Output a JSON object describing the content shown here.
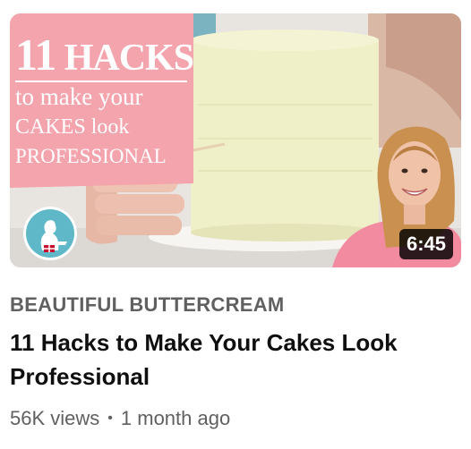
{
  "thumbnail": {
    "title_number": "11",
    "title_word": "HACKS",
    "title_line2": "to make your",
    "title_line3": "CAKES look",
    "title_line4": "PROFESSIONAL",
    "duration": "6:45",
    "logo_icon": "beautiful-buttercream-logo-icon",
    "panel_color": "#f4a4ad",
    "cake_color": "#efefc8"
  },
  "channel": {
    "name": "BEAUTIFUL BUTTERCREAM"
  },
  "video": {
    "title": "11 Hacks to Make Your Cakes Look Professional"
  },
  "meta": {
    "views": "56K views",
    "separator": "•",
    "age": "1 month ago"
  }
}
